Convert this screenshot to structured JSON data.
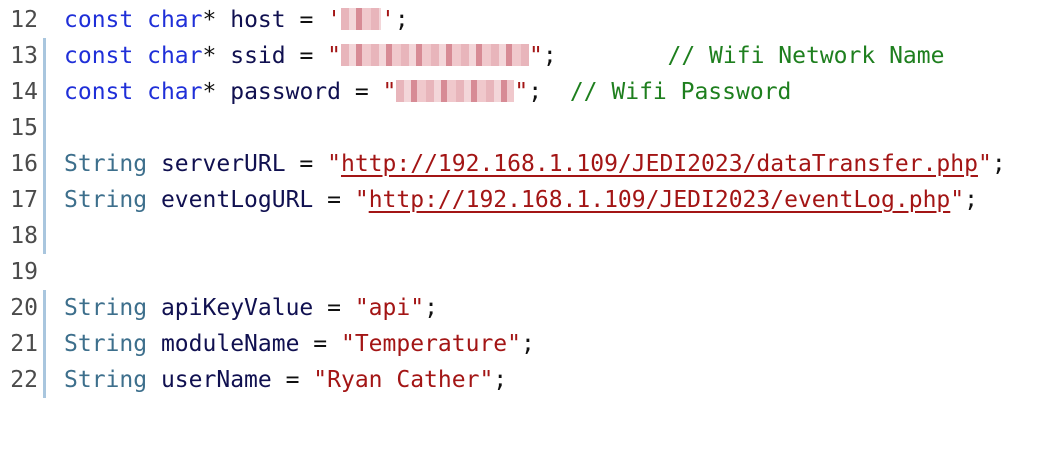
{
  "lines": [
    {
      "num": "12",
      "tokens": {
        "kw1": "const",
        "kw2": "char",
        "star": "*",
        "name": "host",
        "eq": " = ",
        "q1": "'",
        "q2": "'",
        "semi": ";"
      }
    },
    {
      "num": "13",
      "tokens": {
        "kw1": "const",
        "kw2": "char",
        "star": "*",
        "name": "ssid",
        "eq": " = ",
        "q1": "\"",
        "q2": "\"",
        "semi": ";",
        "comment": "// Wifi Network Name"
      }
    },
    {
      "num": "14",
      "tokens": {
        "kw1": "const",
        "kw2": "char",
        "star": "*",
        "name": "password",
        "eq": " = ",
        "q1": "\"",
        "q2": "\"",
        "semi": ";",
        "comment": "// Wifi Password"
      }
    },
    {
      "num": "15"
    },
    {
      "num": "16",
      "tokens": {
        "type": "String",
        "name": "serverURL",
        "eq": " = ",
        "q1": "\"",
        "url": "http://192.168.1.109/JEDI2023/dataTransfer.php",
        "q2": "\"",
        "semi": ";"
      }
    },
    {
      "num": "17",
      "tokens": {
        "type": "String",
        "name": "eventLogURL",
        "eq": " = ",
        "q1": "\"",
        "url": "http://192.168.1.109/JEDI2023/eventLog.php",
        "q2": "\"",
        "semi": ";"
      }
    },
    {
      "num": "18"
    },
    {
      "num": "19"
    },
    {
      "num": "20",
      "tokens": {
        "type": "String",
        "name": "apiKeyValue",
        "eq": " = ",
        "value": "\"api\"",
        "semi": ";"
      }
    },
    {
      "num": "21",
      "tokens": {
        "type": "String",
        "name": "moduleName",
        "eq": " = ",
        "value": "\"Temperature\"",
        "semi": ";"
      }
    },
    {
      "num": "22",
      "tokens": {
        "type": "String",
        "name": "userName",
        "eq": " = ",
        "value": "\"Ryan Cather\"",
        "semi": ";"
      }
    }
  ]
}
